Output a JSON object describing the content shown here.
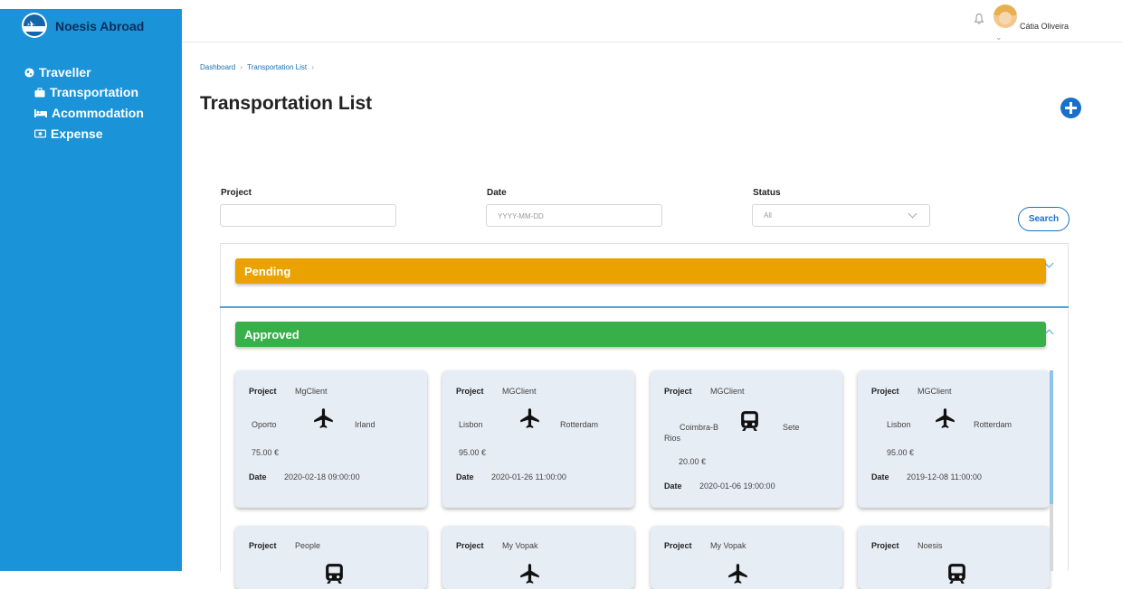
{
  "app": {
    "name": "Noesis Abroad"
  },
  "user": {
    "name": "Cátia Oliveira"
  },
  "sidebar": {
    "items": [
      {
        "label": "Traveller",
        "icon": "globe-icon"
      },
      {
        "label": "Transportation",
        "icon": "suitcase-icon"
      },
      {
        "label": "Acommodation",
        "icon": "bed-icon"
      },
      {
        "label": "Expense",
        "icon": "money-icon"
      }
    ]
  },
  "breadcrumb": {
    "items": [
      "Dashboard",
      "Transportation List"
    ],
    "separator": "›"
  },
  "page": {
    "title": "Transportation List"
  },
  "filters": {
    "project_label": "Project",
    "project_value": "",
    "date_label": "Date",
    "date_placeholder": "YYYY-MM-DD",
    "status_label": "Status",
    "status_value": "All",
    "search_label": "Search"
  },
  "groups": [
    {
      "label": "Pending",
      "color": "#e9a200"
    },
    {
      "label": "Approved",
      "color": "#38b04a"
    }
  ],
  "card_labels": {
    "project": "Project",
    "date": "Date"
  },
  "cards": [
    {
      "project": "MgClient",
      "from": "Oporto",
      "to": "Irland",
      "mode": "plane-icon",
      "price": "75.00 €",
      "date": "2020-02-18 09:00:00"
    },
    {
      "project": "MGClient",
      "from": "Lisbon",
      "to": "Rotterdam",
      "mode": "plane-icon",
      "price": "95.00 €",
      "date": "2020-01-26 11:00:00"
    },
    {
      "project": "MGClient",
      "from": "Coimbra-B",
      "from_line2": "Rios",
      "to": "Sete",
      "mode": "train-icon",
      "price": "20.00 €",
      "date": "2020-01-06 19:00:00"
    },
    {
      "project": "MGClient",
      "from": "Lisbon",
      "to": "Rotterdam",
      "mode": "plane-icon",
      "price": "95.00 €",
      "date": "2019-12-08 11:00:00"
    },
    {
      "project": "People",
      "mode": "train-icon"
    },
    {
      "project": "My Vopak",
      "mode": "plane-icon"
    },
    {
      "project": "My Vopak",
      "mode": "plane-icon"
    },
    {
      "project": "Noesis",
      "mode": "train-icon"
    }
  ],
  "colors": {
    "sidebar": "#1a93d8",
    "accent": "#1a6fc8",
    "pending": "#e9a200",
    "approved": "#38b04a",
    "card": "#e7edf5"
  }
}
